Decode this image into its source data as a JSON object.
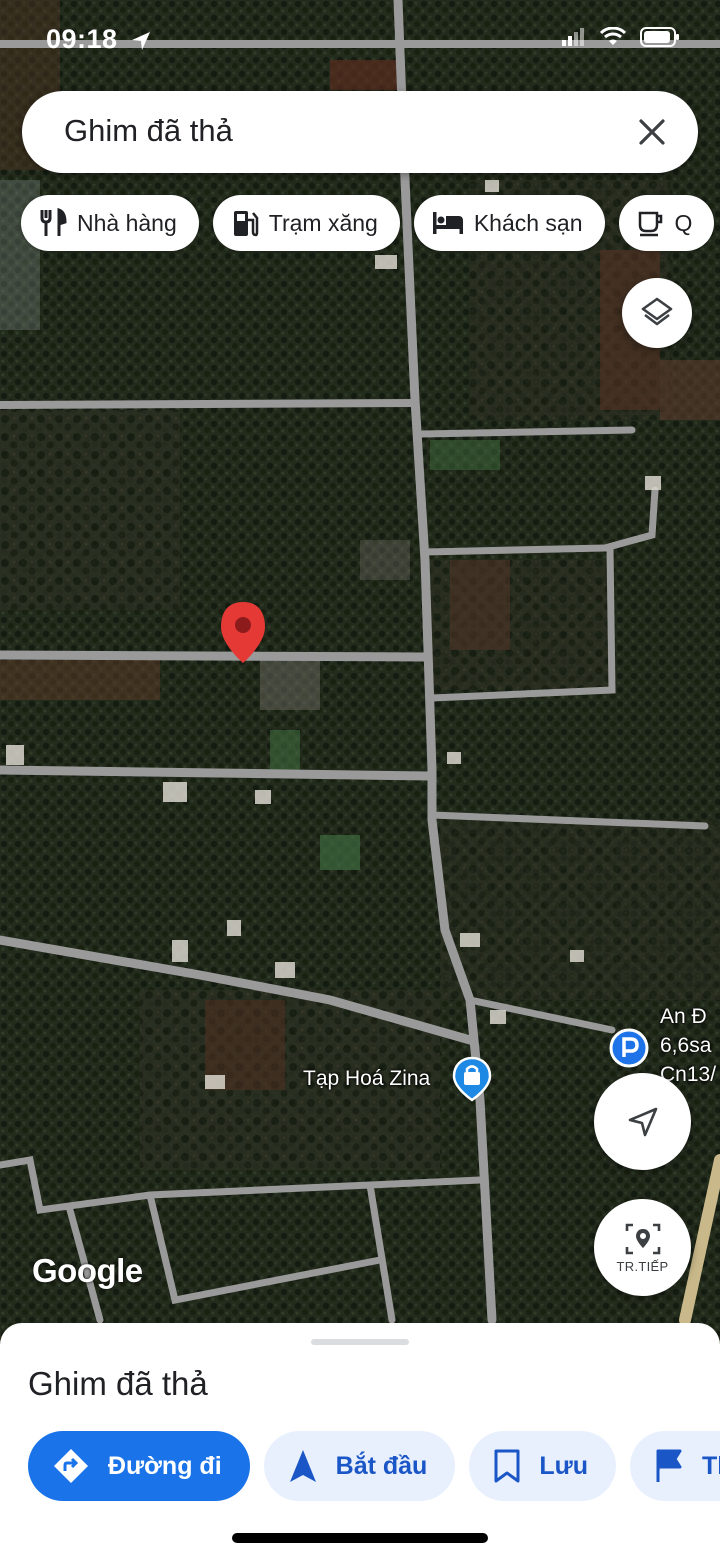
{
  "status_bar": {
    "time": "09:18"
  },
  "search": {
    "value": "Ghim đã thả"
  },
  "chips": [
    {
      "label": "Nhà hàng",
      "icon": "fork-knife-icon"
    },
    {
      "label": "Trạm xăng",
      "icon": "gas-station-icon"
    },
    {
      "label": "Khách sạn",
      "icon": "bed-icon"
    },
    {
      "label": "Q",
      "icon": "coffee-cup-icon"
    }
  ],
  "map": {
    "attribution": "Google",
    "poi_shop": {
      "label": "Tạp Hoá Zina",
      "icon": "shopping-bag-icon"
    },
    "poi_parking": {
      "line1": "An Đ",
      "line2": "6,6sa",
      "line3": "Cn13/",
      "icon": "parking-icon"
    },
    "pin": {
      "icon": "red-map-pin-icon",
      "color": "#e53935"
    },
    "live_view_label": "TR.TIẾP"
  },
  "sheet": {
    "title": "Ghim đã thả",
    "actions": [
      {
        "label": "Đường đi",
        "icon": "directions-icon",
        "primary": true
      },
      {
        "label": "Bắt đầu",
        "icon": "navigation-arrow-icon"
      },
      {
        "label": "Lưu",
        "icon": "bookmark-icon"
      },
      {
        "label": "Th",
        "icon": "flag-icon"
      }
    ]
  },
  "colors": {
    "accent": "#1a73e8",
    "accent_light": "#e8f0fe",
    "road": "#9a9a9a"
  }
}
